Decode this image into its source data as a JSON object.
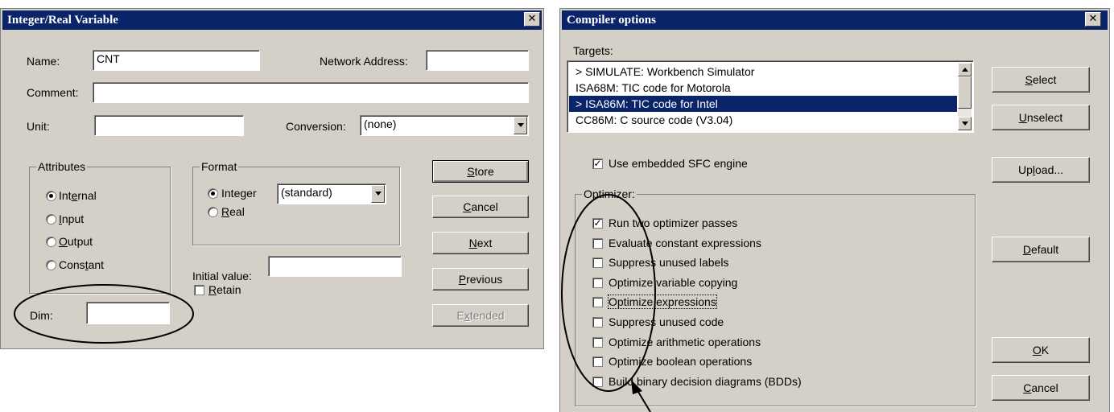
{
  "left_dialog": {
    "title": "Integer/Real Variable",
    "name_label": "Name:",
    "name_value": "CNT",
    "network_label": "Network Address:",
    "network_value": "",
    "comment_label": "Comment:",
    "comment_value": "",
    "unit_label": "Unit:",
    "unit_value": "",
    "conversion_label": "Conversion:",
    "conversion_value": "(none)",
    "attributes_title": "Attributes",
    "attributes": [
      {
        "pre": "Int",
        "key": "e",
        "post": "rnal",
        "checked": true
      },
      {
        "pre": "",
        "key": "I",
        "post": "nput",
        "checked": false
      },
      {
        "pre": "",
        "key": "O",
        "post": "utput",
        "checked": false
      },
      {
        "pre": "Cons",
        "key": "t",
        "post": "ant",
        "checked": false
      }
    ],
    "format_title": "Format",
    "format_integer": {
      "pre": "Inte",
      "key": "g",
      "post": "er"
    },
    "format_real": {
      "pre": "",
      "key": "R",
      "post": "eal"
    },
    "format_combo_value": "(standard)",
    "initial_value_label": "Initial value:",
    "initial_value": "",
    "retain": {
      "pre": "",
      "key": "R",
      "post": "etain",
      "checked": false
    },
    "dim_label": "Dim:",
    "dim_value": "",
    "buttons": {
      "store": {
        "pre": "",
        "key": "S",
        "post": "tore"
      },
      "cancel": {
        "pre": "",
        "key": "C",
        "post": "ancel"
      },
      "next": {
        "pre": "",
        "key": "N",
        "post": "ext"
      },
      "previous": {
        "pre": "",
        "key": "P",
        "post": "revious"
      },
      "extended": {
        "pre": "E",
        "key": "x",
        "post": "tended"
      }
    }
  },
  "right_dialog": {
    "title": "Compiler options",
    "targets_label": "Targets:",
    "targets": [
      {
        "text": "> SIMULATE: Workbench Simulator",
        "selected": false
      },
      {
        "text": "ISA68M: TIC code for Motorola",
        "selected": false
      },
      {
        "text": "> ISA86M: TIC code for Intel",
        "selected": true
      },
      {
        "text": "CC86M: C source code (V3.04)",
        "selected": false
      }
    ],
    "embedded_sfc": {
      "text": "Use embedded SFC engine",
      "checked": true
    },
    "optimizer_title": "Optimizer:",
    "optimizer_options": [
      {
        "text": "Run two optimizer passes",
        "checked": true
      },
      {
        "text": "Evaluate constant expressions",
        "checked": false
      },
      {
        "text": "Suppress unused labels",
        "checked": false
      },
      {
        "text": "Optimize variable copying",
        "checked": false
      },
      {
        "text": "Optimize expressions",
        "checked": false
      },
      {
        "text": "Suppress unused code",
        "checked": false
      },
      {
        "text": "Optimize arithmetic operations",
        "checked": false
      },
      {
        "text": "Optimize boolean operations",
        "checked": false
      },
      {
        "text": "Build binary decision diagrams (BDDs)",
        "checked": false
      }
    ],
    "buttons": {
      "select": {
        "pre": "",
        "key": "S",
        "post": "elect"
      },
      "unselect": {
        "pre": "",
        "key": "U",
        "post": "nselect"
      },
      "upload": {
        "pre": "Up",
        "key": "l",
        "post": "oad..."
      },
      "default": {
        "pre": "",
        "key": "D",
        "post": "efault"
      },
      "ok": {
        "pre": "",
        "key": "O",
        "post": "K"
      },
      "cancel": {
        "pre": "",
        "key": "C",
        "post": "ancel"
      }
    }
  },
  "colors": {
    "titlebar": "#0a246a",
    "face": "#d4d0c8",
    "selection": "#0a246a"
  }
}
